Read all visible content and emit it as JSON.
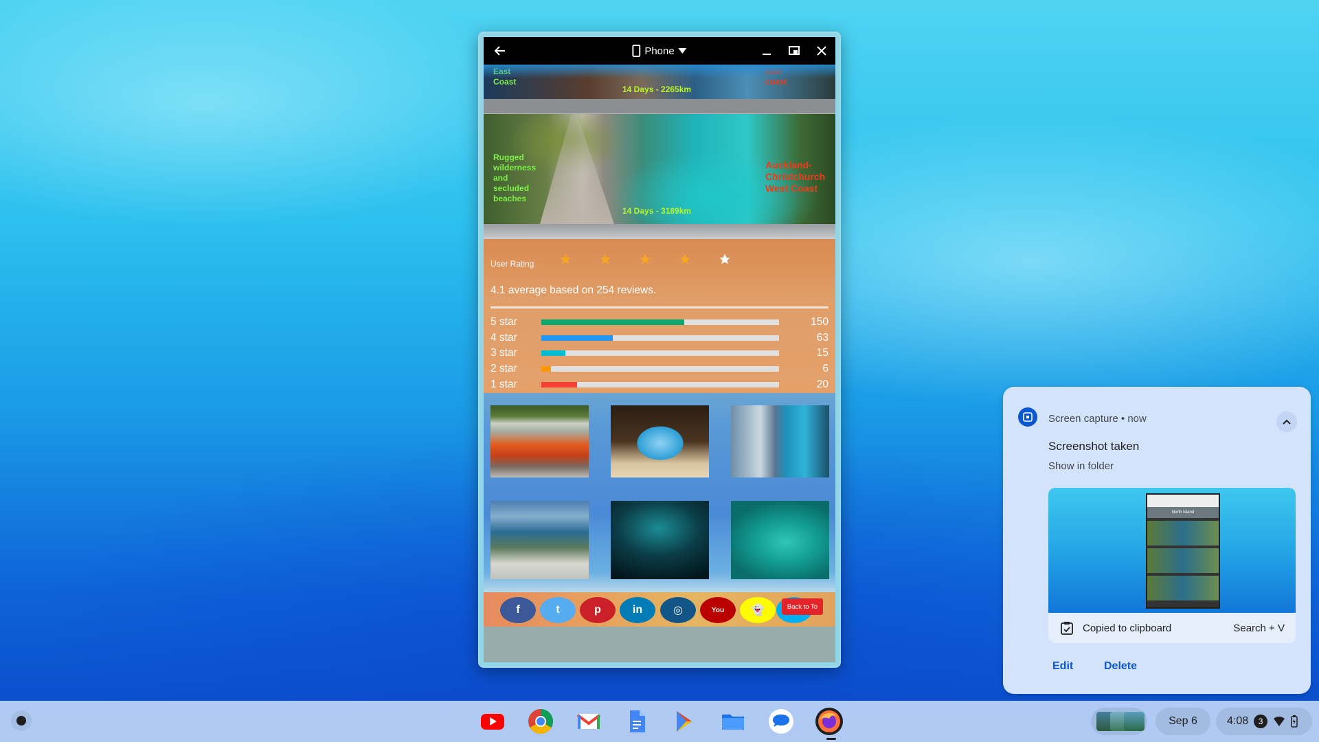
{
  "window": {
    "device_label": "Phone",
    "tours": [
      {
        "left_text": "East Coast",
        "stats": "14 Days - 2265km",
        "right_text": "east coast"
      },
      {
        "left_text": "Rugged wilderness and secluded beaches",
        "stats": "14 Days - 3189km",
        "right_text": "Auckland-Christchurch West Coast"
      }
    ],
    "rating": {
      "label": "User Rating",
      "stars_filled": 4,
      "stars_total": 5,
      "average_text": "4.1 average based on 254 reviews.",
      "bars": [
        {
          "label": "5 star",
          "count": "150",
          "fraction": 0.6,
          "color": "#04aa6d"
        },
        {
          "label": "4 star",
          "count": "63",
          "fraction": 0.3,
          "color": "#2196f3"
        },
        {
          "label": "3 star",
          "count": "15",
          "fraction": 0.1,
          "color": "#00bcd4"
        },
        {
          "label": "2 star",
          "count": "6",
          "fraction": 0.04,
          "color": "#ff9800"
        },
        {
          "label": "1 star",
          "count": "20",
          "fraction": 0.15,
          "color": "#f44336"
        }
      ]
    },
    "social": {
      "buttons": [
        {
          "name": "facebook",
          "glyph": "f",
          "color": "#3b5998"
        },
        {
          "name": "twitter",
          "glyph": "t",
          "color": "#55acee"
        },
        {
          "name": "pinterest",
          "glyph": "p",
          "color": "#cb2027"
        },
        {
          "name": "linkedin",
          "glyph": "in",
          "color": "#007bb5"
        },
        {
          "name": "instagram",
          "glyph": "◎",
          "color": "#125688"
        },
        {
          "name": "youtube",
          "glyph": "You",
          "color": "#bb0000"
        },
        {
          "name": "snapchat",
          "glyph": "👻",
          "color": "#fffc00"
        },
        {
          "name": "skype",
          "glyph": "",
          "color": "#00aff0"
        }
      ],
      "back_to_top": "Back to To"
    }
  },
  "notification": {
    "app": "Screen capture",
    "time": "now",
    "title": "Screenshot taken",
    "subtitle": "Show in folder",
    "clipboard_text": "Copied to clipboard",
    "shortcut": "Search + V",
    "actions": {
      "edit": "Edit",
      "delete": "Delete"
    },
    "preview_title": "North Island"
  },
  "shelf": {
    "apps": [
      {
        "name": "youtube-icon"
      },
      {
        "name": "chrome-icon"
      },
      {
        "name": "gmail-icon"
      },
      {
        "name": "docs-icon"
      },
      {
        "name": "play-store-icon"
      },
      {
        "name": "files-icon"
      },
      {
        "name": "messages-icon"
      },
      {
        "name": "firefox-icon"
      }
    ],
    "date": "Sep 6",
    "time": "4:08",
    "notification_count": "3"
  }
}
